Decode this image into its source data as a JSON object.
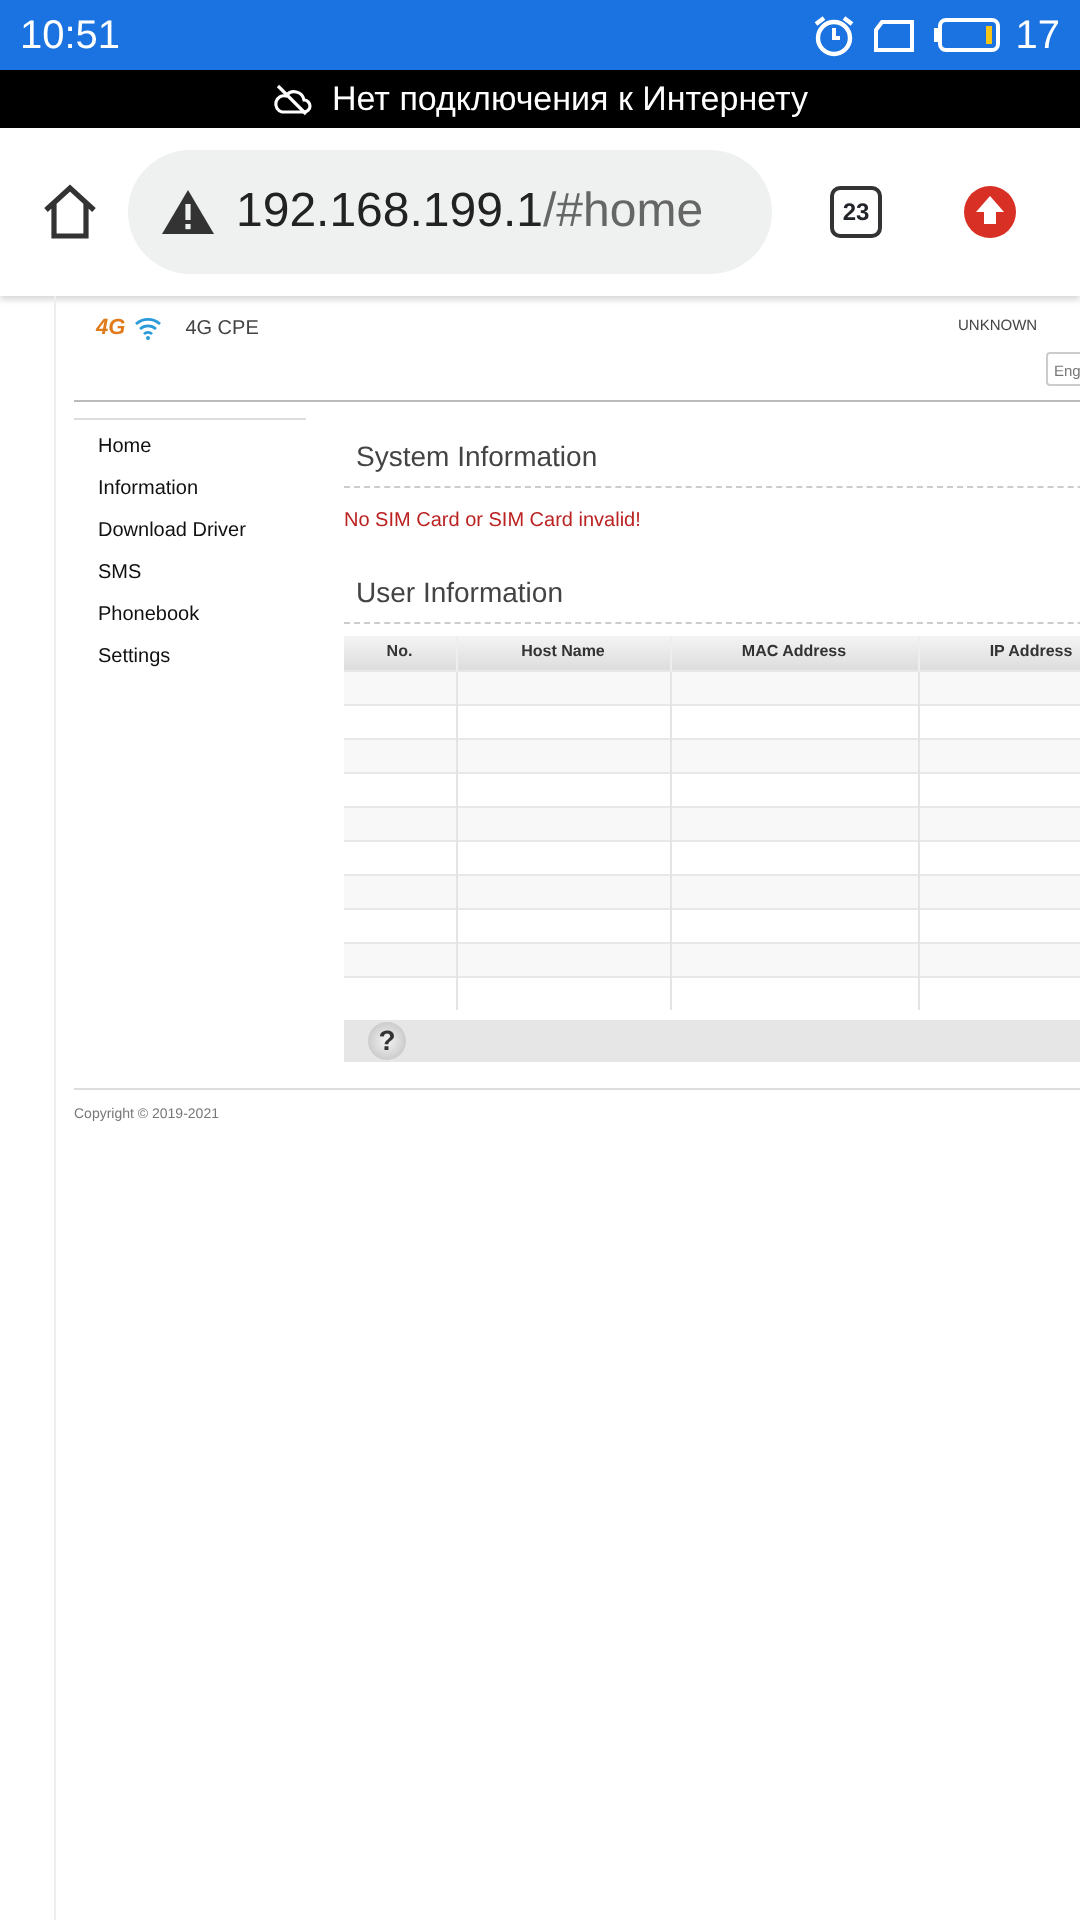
{
  "status_bar": {
    "time": "10:51",
    "battery_percent": "17"
  },
  "offline_banner": {
    "text": "Нет подключения к Интернету"
  },
  "browser": {
    "url_host": "192.168.199.1",
    "url_path": "/#home",
    "tab_count": "23"
  },
  "router_page": {
    "logo_text": "4G",
    "product": "4G CPE",
    "network_status": "UNKNOWN",
    "language": "Eng",
    "menu": [
      "Home",
      "Information",
      "Download Driver",
      "SMS",
      "Phonebook",
      "Settings"
    ],
    "sections": [
      {
        "title": "System Information",
        "message": "No SIM Card or SIM Card invalid!"
      },
      {
        "title": "User Information"
      }
    ],
    "table": {
      "columns": [
        "No.",
        "Host Name",
        "MAC Address",
        "IP Address"
      ]
    },
    "help_button": "?",
    "copyright": "Copyright © 2019-2021"
  }
}
